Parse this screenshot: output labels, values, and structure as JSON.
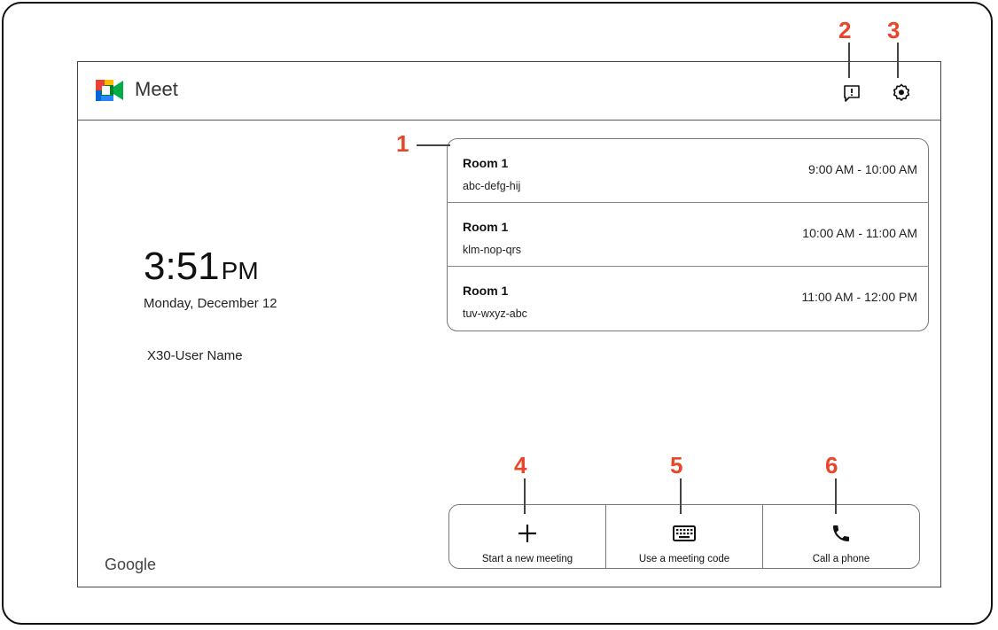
{
  "header": {
    "app_name": "Meet",
    "logo_icon": "google-meet-logo"
  },
  "clock": {
    "time": "3:51",
    "ampm": "PM",
    "date": "Monday, December 12"
  },
  "device": {
    "user_name": "X30-User Name",
    "brand": "Google"
  },
  "meetings": [
    {
      "title": "Room 1",
      "code": "abc-defg-hij",
      "time": "9:00 AM - 10:00 AM"
    },
    {
      "title": "Room 1",
      "code": "klm-nop-qrs",
      "time": "10:00 AM - 11:00 AM"
    },
    {
      "title": "Room 1",
      "code": "tuv-wxyz-abc",
      "time": "11:00 AM - 12:00 PM"
    }
  ],
  "actions": [
    {
      "label": "Start a new meeting",
      "icon": "plus-icon"
    },
    {
      "label": "Use a meeting code",
      "icon": "keyboard-icon"
    },
    {
      "label": "Call a phone",
      "icon": "phone-icon"
    }
  ],
  "toolbar": {
    "feedback_icon": "feedback-icon",
    "settings_icon": "gear-icon"
  },
  "callouts": {
    "c1": "1",
    "c2": "2",
    "c3": "3",
    "c4": "4",
    "c5": "5",
    "c6": "6"
  },
  "colors": {
    "callout": "#e8462a",
    "meet_green": "#00832d",
    "meet_blue": "#0066da",
    "meet_yellow": "#ffba00",
    "meet_red": "#e94235"
  }
}
